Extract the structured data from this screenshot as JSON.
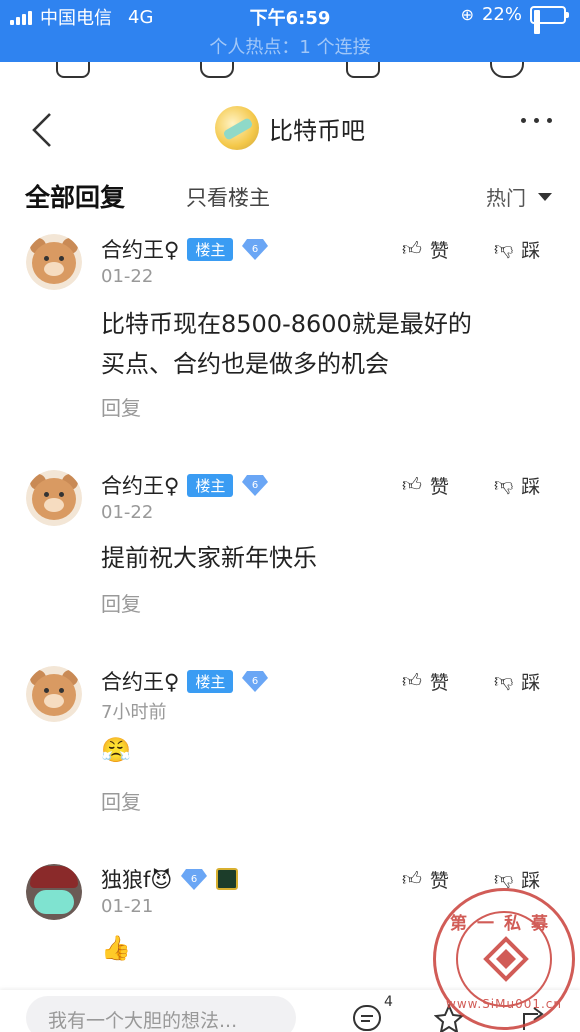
{
  "status": {
    "carrier": "中国电信",
    "network": "4G",
    "time": "下午6:59",
    "battery": "22%",
    "battery_level": 0.22,
    "hotspot": "个人热点：1 个连接"
  },
  "nav": {
    "title": "比特币吧",
    "more_icon": "more-dots-icon",
    "back_icon": "back-arrow-icon"
  },
  "tabs": {
    "all": "全部回复",
    "owner_only": "只看楼主",
    "sort": "热门"
  },
  "actions": {
    "like": "赞",
    "dislike": "踩",
    "reply": "回复"
  },
  "badges": {
    "owner": "楼主",
    "level": "6"
  },
  "posts": [
    {
      "user": "合约王♀",
      "time": "01-22",
      "lines": [
        "比特币现在8500-8600就是最好的",
        "买点、合约也是做多的机会"
      ]
    },
    {
      "user": "合约王♀",
      "time": "01-22",
      "lines": [
        "提前祝大家新年快乐"
      ]
    },
    {
      "user": "合约王♀",
      "time": "7小时前",
      "emoji": "😤"
    },
    {
      "user": "独狼f😈",
      "time": "01-21",
      "emoji": "👍"
    }
  ],
  "bottom": {
    "placeholder": "我有一个大胆的想法...",
    "comment_count": "4"
  },
  "watermark": {
    "top": "第一私募",
    "bottom": "www.SiMu001.cn"
  },
  "colors": {
    "status_bar": "#2f83f0",
    "badge": "#3a9cf3",
    "stamp": "#c9403a"
  }
}
